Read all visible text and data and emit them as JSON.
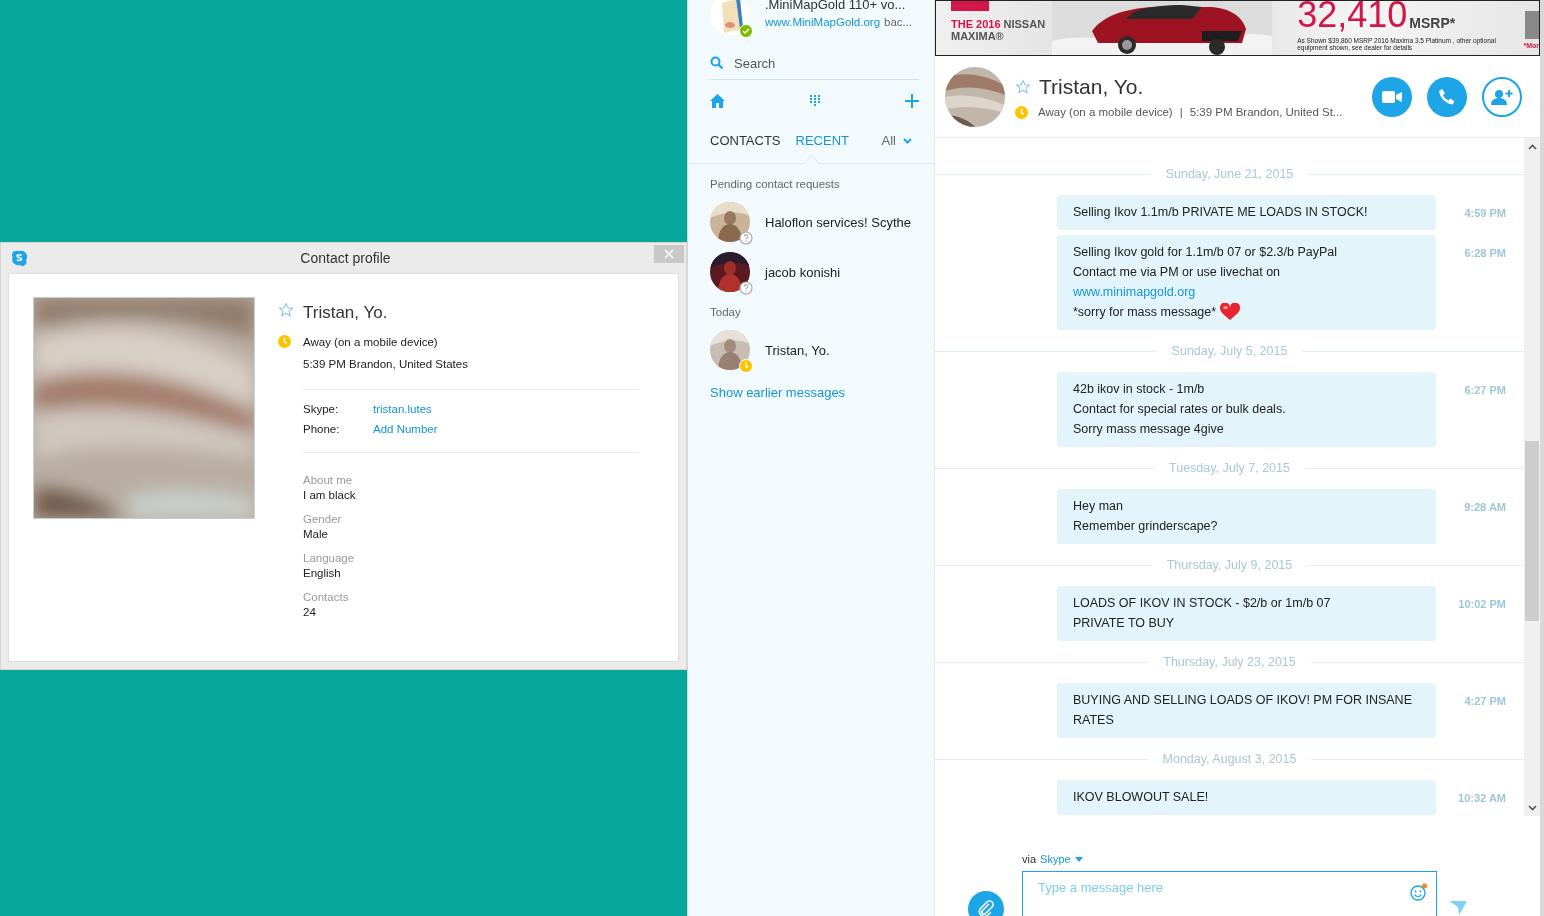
{
  "profile_window": {
    "title": "Contact profile",
    "name": "Tristan, Yo.",
    "favorite": false,
    "away": true,
    "status": "Away (on a mobile device)",
    "local_time": "5:39 PM Brandon, United States",
    "accounts": [
      {
        "label": "Skype:",
        "value": "tristan.lutes"
      },
      {
        "label": "Phone:",
        "value": "Add Number"
      }
    ],
    "about": [
      {
        "label": "About me",
        "value": "I am black"
      },
      {
        "label": "Gender",
        "value": "Male"
      },
      {
        "label": "Language",
        "value": "English"
      },
      {
        "label": "Contacts",
        "value": "24"
      }
    ]
  },
  "sidebar": {
    "profile": {
      "name": ".MiniMapGold 110+ vo...",
      "mood_link": "www.MiniMapGold.org",
      "mood_rest": "bac...",
      "online": true
    },
    "search": {
      "placeholder": "Search"
    },
    "tabs": [
      {
        "label": "CONTACTS",
        "selected": false
      },
      {
        "label": "RECENT",
        "selected": true
      }
    ],
    "filter": "All",
    "sections": [
      {
        "heading": "Pending contact requests",
        "items": [
          {
            "name": "Haloflon services! Scythe",
            "kind": "pending"
          },
          {
            "name": "jacob konishi",
            "kind": "pending"
          }
        ]
      },
      {
        "heading": "Today",
        "items": [
          {
            "name": "Tristan, Yo.",
            "kind": "away"
          }
        ]
      }
    ],
    "show_earlier": "Show earlier messages"
  },
  "ad": {
    "year": "THE 2016",
    "make": "NISSAN",
    "model": "MAXIMA®",
    "price": "32,410",
    "price_suffix": "MSRP*",
    "disclaimer": "As Shown $39,860 MSRP 2016 Maxima 3.5 Platinum , other optional equipment shown, see dealer for details",
    "more": "*Mor"
  },
  "chat": {
    "contact": {
      "name": "Tristan, Yo.",
      "favorite": false,
      "away": true,
      "status": "Away (on a mobile device)",
      "separator": "|",
      "local_time": "5:39 PM Brandon, United St..."
    },
    "days": [
      {
        "date": "Sunday, June 21, 2015",
        "messages": [
          {
            "time": "4:59 PM",
            "lines": [
              {
                "kind": "text",
                "text": "Selling Ikov 1.1m/b PRIVATE ME LOADS IN STOCK!"
              }
            ]
          },
          {
            "time": "6:28 PM",
            "lines": [
              {
                "kind": "text",
                "text": "Selling Ikov gold for 1.1m/b 07 or $2.3/b PayPal"
              },
              {
                "kind": "text",
                "text": "Contact me via PM or use livechat on"
              },
              {
                "kind": "link",
                "text": "www.minimapgold.org"
              },
              {
                "kind": "text_heart",
                "text": "*sorry for mass message*"
              }
            ]
          }
        ]
      },
      {
        "date": "Sunday, July 5, 2015",
        "messages": [
          {
            "time": "6:27 PM",
            "lines": [
              {
                "kind": "text",
                "text": "42b ikov in stock - 1m/b"
              },
              {
                "kind": "text",
                "text": "Contact for special rates or bulk deals."
              },
              {
                "kind": "text",
                "text": "Sorry mass message 4give"
              }
            ]
          }
        ]
      },
      {
        "date": "Tuesday, July 7, 2015",
        "messages": [
          {
            "time": "9:28 AM",
            "lines": [
              {
                "kind": "text",
                "text": "Hey man"
              },
              {
                "kind": "text",
                "text": "Remember grinderscape?"
              }
            ]
          }
        ]
      },
      {
        "date": "Thursday, July 9, 2015",
        "messages": [
          {
            "time": "10:02 PM",
            "lines": [
              {
                "kind": "text",
                "text": "LOADS OF IKOV IN STOCK - $2/b or 1m/b 07"
              },
              {
                "kind": "text",
                "text": "PRIVATE TO BUY"
              }
            ]
          }
        ]
      },
      {
        "date": "Thursday, July 23, 2015",
        "messages": [
          {
            "time": "4:27 PM",
            "lines": [
              {
                "kind": "text",
                "text": "BUYING AND SELLING LOADS OF IKOV! PM FOR INSANE RATES"
              }
            ]
          }
        ]
      },
      {
        "date": "Monday, August 3, 2015",
        "messages": [
          {
            "time": "10:32 AM",
            "lines": [
              {
                "kind": "text",
                "text": "IKOV BLOWOUT SALE!"
              }
            ]
          }
        ]
      }
    ],
    "composer": {
      "via": "via",
      "service": "Skype",
      "placeholder": "Type a message here"
    }
  }
}
